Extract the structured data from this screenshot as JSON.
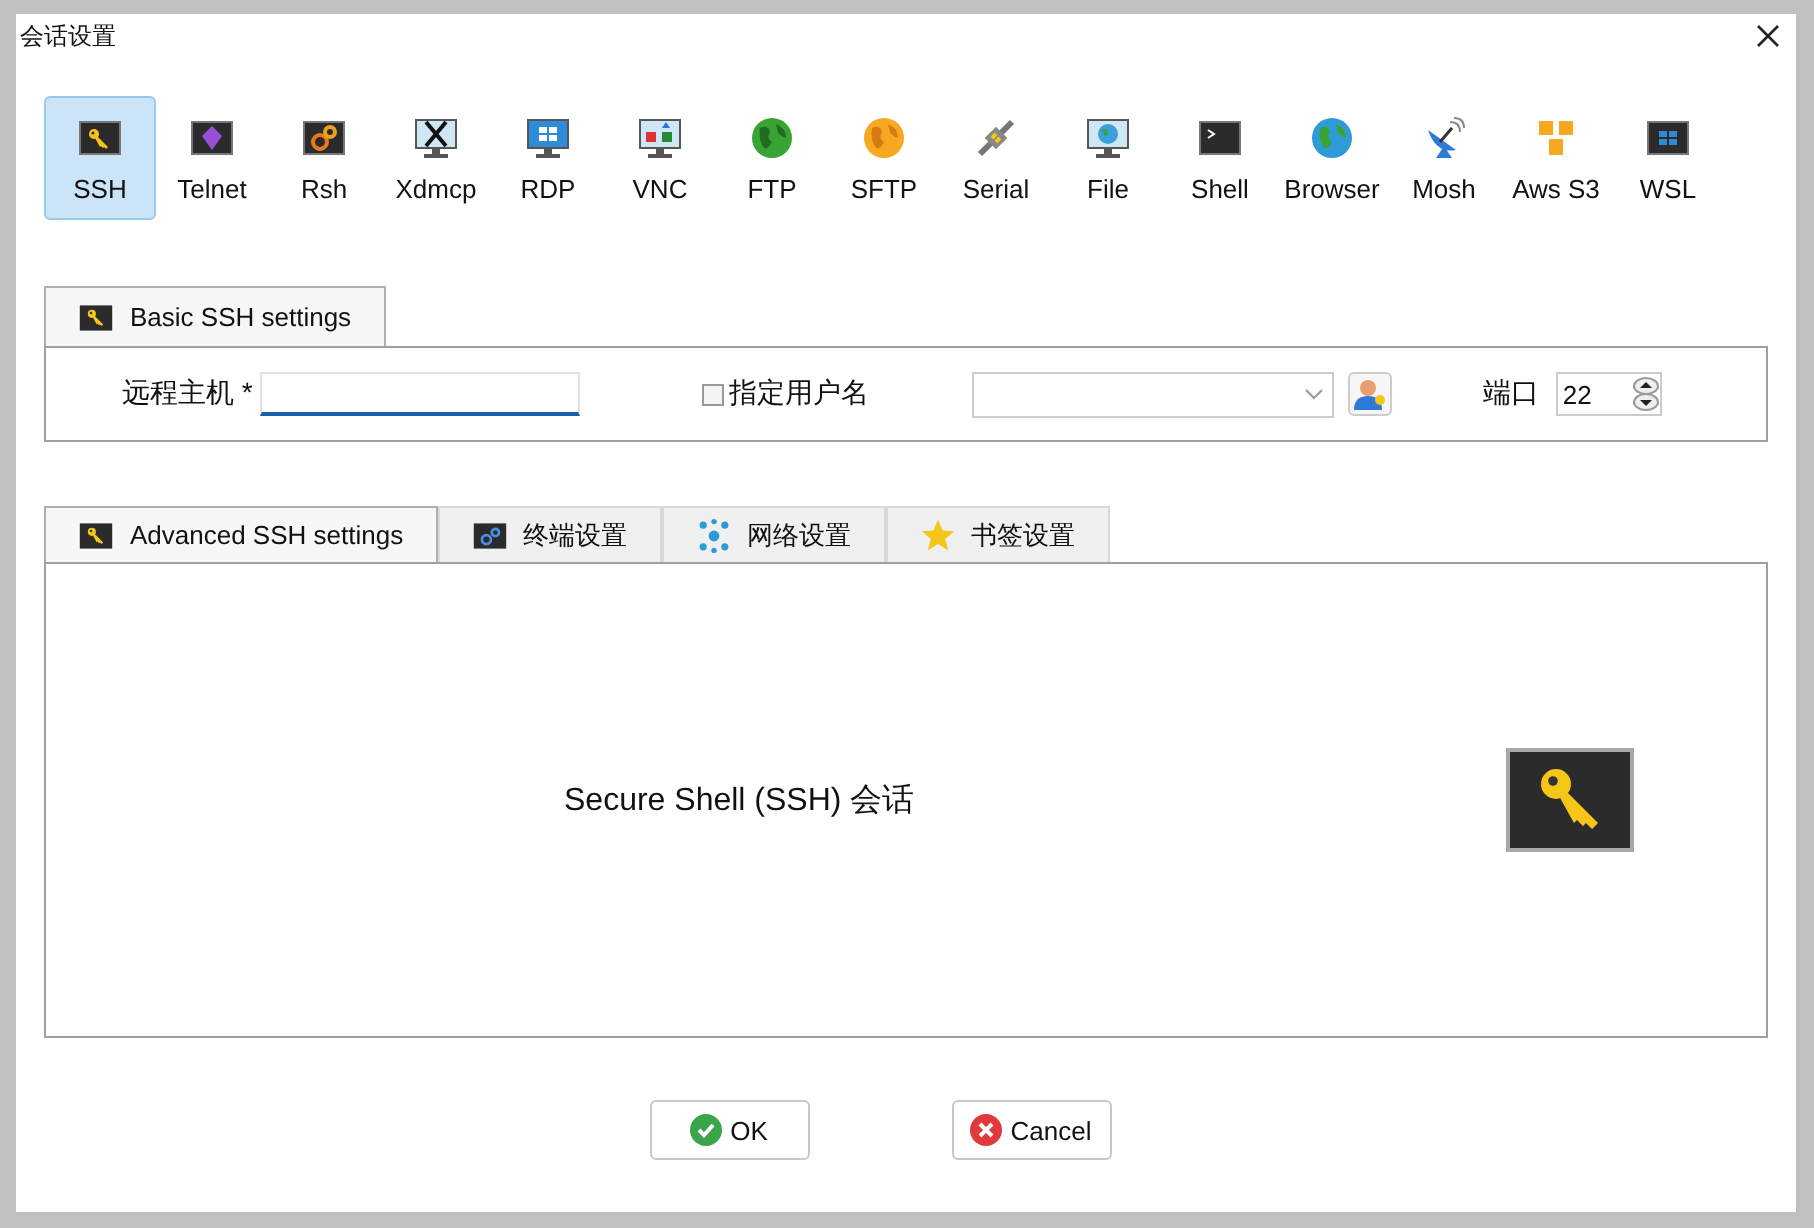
{
  "window": {
    "title": "会话设置"
  },
  "session_types": [
    {
      "label": "SSH",
      "selected": true
    },
    {
      "label": "Telnet",
      "selected": false
    },
    {
      "label": "Rsh",
      "selected": false
    },
    {
      "label": "Xdmcp",
      "selected": false
    },
    {
      "label": "RDP",
      "selected": false
    },
    {
      "label": "VNC",
      "selected": false
    },
    {
      "label": "FTP",
      "selected": false
    },
    {
      "label": "SFTP",
      "selected": false
    },
    {
      "label": "Serial",
      "selected": false
    },
    {
      "label": "File",
      "selected": false
    },
    {
      "label": "Shell",
      "selected": false
    },
    {
      "label": "Browser",
      "selected": false
    },
    {
      "label": "Mosh",
      "selected": false
    },
    {
      "label": "Aws S3",
      "selected": false
    },
    {
      "label": "WSL",
      "selected": false
    }
  ],
  "basic_tab": {
    "label": "Basic SSH settings",
    "selected": true
  },
  "basic_settings": {
    "remote_host": {
      "label": "远程主机 *"
    },
    "username": {
      "label": "指定用户名",
      "checked": false
    },
    "port": {
      "label": "端口",
      "value": "22"
    }
  },
  "advanced_tabs": [
    {
      "label": "Advanced SSH settings",
      "selected": true
    },
    {
      "label": "终端设置",
      "selected": false
    },
    {
      "label": "网络设置",
      "selected": false
    },
    {
      "label": "书签设置",
      "selected": false
    }
  ],
  "description": "Secure Shell (SSH) 会话",
  "buttons": [
    {
      "label": "OK",
      "kind": "ok"
    },
    {
      "label": "Cancel",
      "kind": "cancel"
    }
  ]
}
